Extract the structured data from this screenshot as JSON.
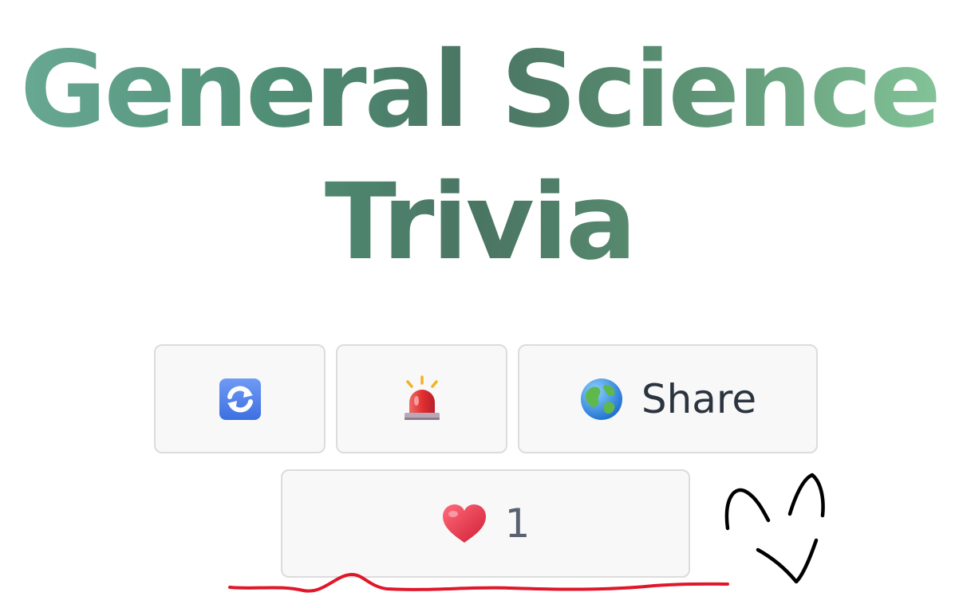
{
  "page": {
    "title_line1": "General Science",
    "title_line2": "Trivia"
  },
  "toolbar": {
    "refresh_icon": "refresh-icon",
    "alert_icon": "police-light-icon",
    "share_icon": "globe-icon",
    "share_label": "Share",
    "like_icon": "heart-icon",
    "like_count": "1"
  },
  "colors": {
    "title_gradient": [
      "#6aab96",
      "#4a7563",
      "#86c79a"
    ],
    "button_bg": "#f8f8f8",
    "button_border": "#dcdcdc",
    "annotation_red": "#e0162b",
    "annotation_black": "#000000"
  }
}
